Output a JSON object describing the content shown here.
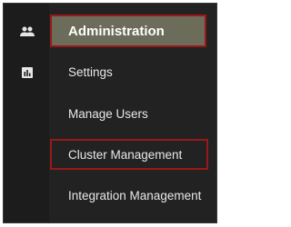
{
  "rail": {
    "items": [
      {
        "icon": "users-icon"
      },
      {
        "icon": "chart-icon"
      }
    ]
  },
  "menu": {
    "items": [
      {
        "label": "Administration",
        "state": "active"
      },
      {
        "label": "Settings"
      },
      {
        "label": "Manage Users"
      },
      {
        "label": "Cluster Management",
        "state": "highlighted"
      },
      {
        "label": "Integration Management"
      }
    ]
  },
  "colors": {
    "background": "#222222",
    "active_bg": "#6b6c5a",
    "highlight_border": "#9a1818",
    "text": "#e8e8e8"
  }
}
